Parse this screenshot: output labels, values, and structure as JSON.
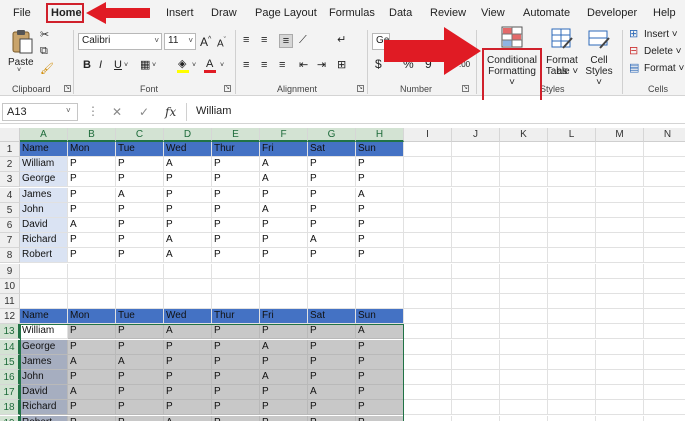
{
  "menu": {
    "tabs": [
      "File",
      "Home",
      "Insert",
      "Draw",
      "Page Layout",
      "Formulas",
      "Data",
      "Review",
      "View",
      "Automate",
      "Developer",
      "Help"
    ],
    "active_tab": "Home"
  },
  "ribbon": {
    "clipboard": {
      "paste_label": "Paste",
      "group_label": "Clipboard"
    },
    "font": {
      "font_name": "Calibri",
      "font_size": "11",
      "grow_label": "A",
      "shrink_label": "A",
      "bold": "B",
      "italic": "I",
      "underline": "U",
      "font_color_letter": "A",
      "group_label": "Font"
    },
    "alignment": {
      "group_label": "Alignment"
    },
    "number": {
      "format_value": "Ge",
      "currency": "$",
      "percent": "%",
      "comma": "9",
      "group_label": "Number"
    },
    "styles": {
      "conditional_formatting_line1": "Conditional",
      "conditional_formatting_line2": "Formatting ˅",
      "format_as_table_line1": "Format as",
      "format_as_table_line2": "Table ˅",
      "cell_styles_line1": "Cell",
      "cell_styles_line2": "Styles ˅",
      "group_label": "Styles"
    },
    "cells": {
      "insert": "Insert ˅",
      "delete": "Delete ˅",
      "format": "Format ˅",
      "group_label": "Cells"
    }
  },
  "formula_bar": {
    "name_box": "A13",
    "fx": "fx",
    "value": "William"
  },
  "grid": {
    "columns": [
      "A",
      "B",
      "C",
      "D",
      "E",
      "F",
      "G",
      "H",
      "I",
      "J",
      "K",
      "L",
      "M",
      "N"
    ],
    "rows": [
      "1",
      "2",
      "3",
      "4",
      "5",
      "6",
      "7",
      "8",
      "9",
      "10",
      "11",
      "12",
      "13",
      "14",
      "15",
      "16",
      "17",
      "18",
      "19"
    ],
    "table1": {
      "header": [
        "Name",
        "Mon",
        "Tue",
        "Wed",
        "Thur",
        "Fri",
        "Sat",
        "Sun"
      ],
      "rows": [
        [
          "William",
          "P",
          "P",
          "A",
          "P",
          "A",
          "P",
          "P"
        ],
        [
          "George",
          "P",
          "P",
          "P",
          "P",
          "A",
          "P",
          "P"
        ],
        [
          "James",
          "P",
          "A",
          "P",
          "P",
          "P",
          "P",
          "A"
        ],
        [
          "John",
          "P",
          "P",
          "P",
          "P",
          "A",
          "P",
          "P"
        ],
        [
          "David",
          "A",
          "P",
          "P",
          "P",
          "P",
          "P",
          "P"
        ],
        [
          "Richard",
          "P",
          "P",
          "A",
          "P",
          "P",
          "A",
          "P"
        ],
        [
          "Robert",
          "P",
          "P",
          "A",
          "P",
          "P",
          "P",
          "P"
        ]
      ]
    },
    "table2": {
      "header": [
        "Name",
        "Mon",
        "Tue",
        "Wed",
        "Thur",
        "Fri",
        "Sat",
        "Sun"
      ],
      "rows": [
        [
          "William",
          "P",
          "P",
          "A",
          "P",
          "P",
          "P",
          "A"
        ],
        [
          "George",
          "P",
          "P",
          "P",
          "P",
          "A",
          "P",
          "P"
        ],
        [
          "James",
          "A",
          "A",
          "P",
          "P",
          "P",
          "P",
          "P"
        ],
        [
          "John",
          "P",
          "P",
          "P",
          "P",
          "A",
          "P",
          "P"
        ],
        [
          "David",
          "A",
          "P",
          "P",
          "P",
          "P",
          "A",
          "P"
        ],
        [
          "Richard",
          "P",
          "P",
          "P",
          "P",
          "P",
          "P",
          "P"
        ],
        [
          "Robert",
          "P",
          "P",
          "A",
          "P",
          "P",
          "P",
          "P"
        ]
      ]
    }
  },
  "colors": {
    "accent_red": "#d0202b",
    "header_blue": "#4472c4",
    "name_column_light_blue": "#dae3f3",
    "selection_gray": "#c8c8c8",
    "excel_green": "#217346"
  }
}
